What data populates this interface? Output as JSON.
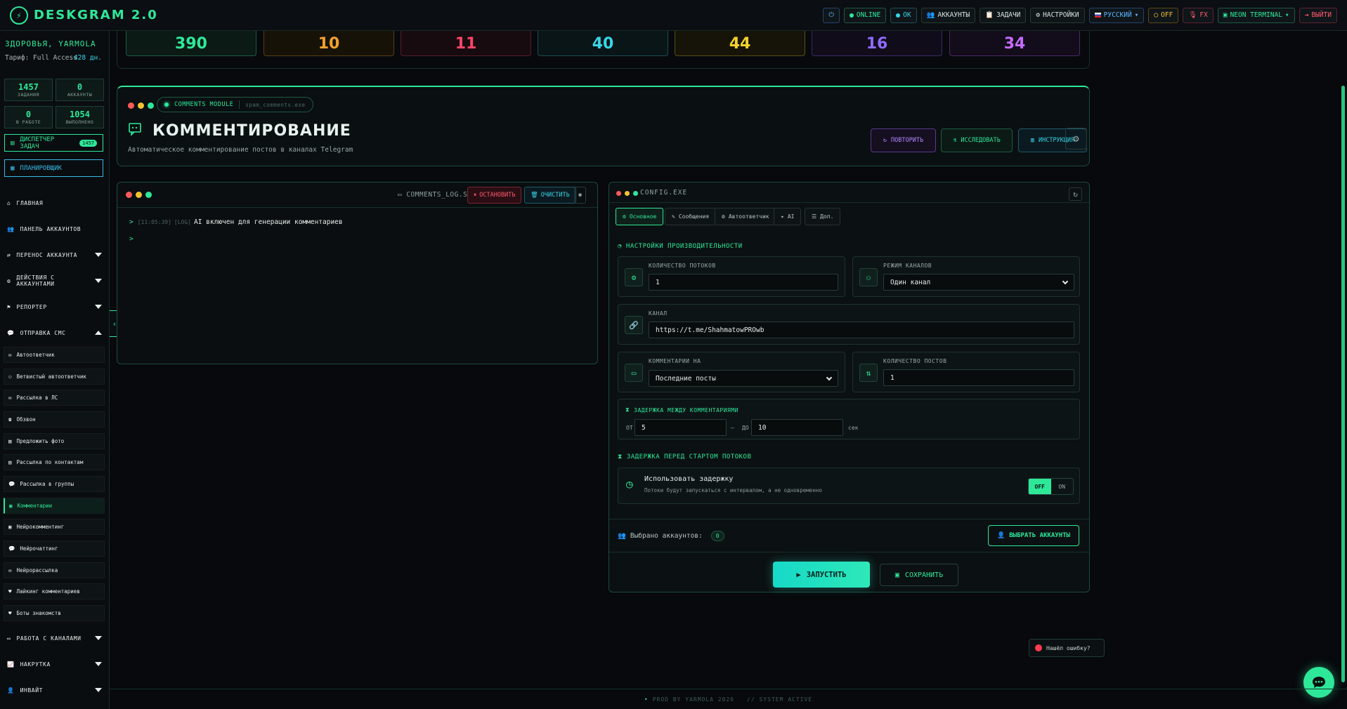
{
  "topbar": {
    "brand": "DESKGRAM 2.0",
    "status_online": "ONLINE",
    "status_ok": "OK",
    "accounts": "АККАУНТЫ",
    "tasks": "ЗАДАЧИ",
    "settings": "НАСТРОЙКИ",
    "language": "РУССКИЙ",
    "fx_off": "OFF",
    "fx": "FX",
    "theme": "NEON TERMINAL",
    "logout": "ВЫЙТИ"
  },
  "sidebar": {
    "user": "ЗДОРОВЬЯ, YARMOLA",
    "tariff": "Тариф: Full Access",
    "days": "428 дн.",
    "stats": [
      {
        "value": "1457",
        "label": "ЗАДАНИЯ"
      },
      {
        "value": "0",
        "label": "АККАУНТЫ"
      },
      {
        "value": "0",
        "label": "В РАБОТЕ"
      },
      {
        "value": "1054",
        "label": "ВЫПОЛНЕНО"
      }
    ],
    "task_manager": "ДИСПЕТЧЕР ЗАДАЧ",
    "task_manager_badge": "1457",
    "scheduler": "ПЛАНИРОВЩИК",
    "nav": {
      "home": "ГЛАВНАЯ",
      "accounts_panel": "ПАНЕЛЬ АККАУНТОВ",
      "transfer": "ПЕРЕНОС АККАУНТА",
      "actions": "ДЕЙСТВИЯ С АККАУНТАМИ",
      "reporter": "РЕПОРТЕР",
      "sms": "ОТПРАВКА СМС",
      "channels": "РАБОТА С КАНАЛАМИ",
      "boost": "НАКРУТКА",
      "invite": "ИНВАЙТ"
    },
    "sub": [
      "Автоответчик",
      "Ветвистый автоответчик",
      "Рассылка в ЛС",
      "Обзвон",
      "Предложить фото",
      "Рассылка по контактам",
      "Рассылка в группы",
      "Комментарии",
      "Нейрокомментинг",
      "Нейрочаттинг",
      "Нейрорассылка",
      "Лайкинг комментариев",
      "Боты знакомств"
    ]
  },
  "counters": [
    "390",
    "10",
    "11",
    "40",
    "44",
    "16",
    "34"
  ],
  "header": {
    "module": "COMMENTS MODULE",
    "file": "spam_comments.exe",
    "title": "КОММЕНТИРОВАНИЕ",
    "subtitle": "Автоматическое комментирование постов в каналах Telegram",
    "repeat": "ПОВТОРИТЬ",
    "research": "ИССЛЕДОВАТЬ",
    "instruction": "ИНСТРУКЦИЯ"
  },
  "log": {
    "file": "COMMENTS_LOG.SH",
    "stop": "ОСТАНОВИТЬ",
    "clear": "ОЧИСТИТЬ",
    "time": "[11:05:39]",
    "tag": "[LOG]",
    "message": "AI включен для генерации комментариев",
    "prompt": ">"
  },
  "config": {
    "title": "CONFIG.EXE",
    "tabs": [
      "Основное",
      "Сообщения",
      "Автоответчик",
      "AI",
      "Доп."
    ],
    "perf_title": "НАСТРОЙКИ ПРОИЗВОДИТЕЛЬНОСТИ",
    "threads_label": "КОЛИЧЕСТВО ПОТОКОВ",
    "threads_value": "1",
    "channel_mode_label": "РЕЖИМ КАНАЛОВ",
    "channel_mode_value": "Один канал",
    "channel_label": "КАНАЛ",
    "channel_value": "https://t.me/ShahmatowPROwb",
    "comment_on_label": "КОММЕНТАРИИ НА",
    "comment_on_value": "Последние посты",
    "posts_count_label": "КОЛИЧЕСТВО ПОСТОВ",
    "posts_count_value": "1",
    "delay_title": "ЗАДЕРЖКА МЕЖДУ КОММЕНТАРИЯМИ",
    "from_label": "ОТ",
    "from_value": "5",
    "to_label": "ДО",
    "to_value": "10",
    "sec": "сек",
    "start_delay_title": "ЗАДЕРЖКА ПЕРЕД СТАРТОМ ПОТОКОВ",
    "use_delay": "Использовать задержку",
    "use_delay_desc": "Потоки будут запускаться с интервалом, а не одновременно",
    "off": "OFF",
    "on": "ON",
    "selected_label": "Выбрано аккаунтов:",
    "selected_value": "0",
    "choose_accounts": "ВЫБРАТЬ АККАУНТЫ",
    "launch": "ЗАПУСТИТЬ",
    "save": "СОХРАНИТЬ"
  },
  "bug_report": "Нашёл ошибку?",
  "footer": {
    "prod": "PROD BY YARMOLA 2026",
    "status": "// SYSTEM ACTIVE"
  },
  "colors": {
    "accent": "#2ee89a",
    "cyan": "#37d6e6",
    "background": "#07090c"
  }
}
